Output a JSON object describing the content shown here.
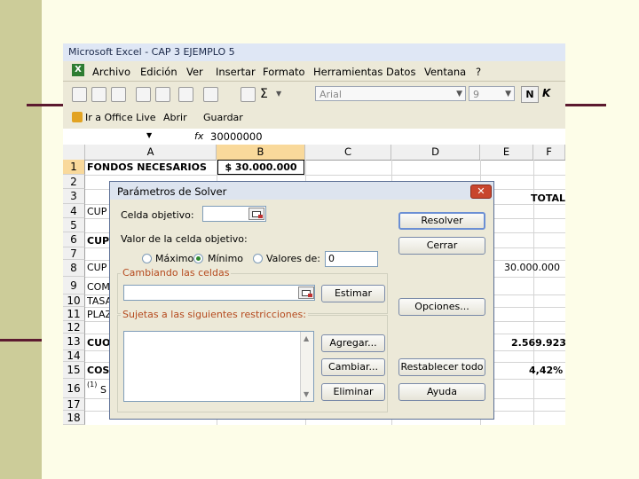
{
  "window": {
    "title": "Microsoft Excel - CAP 3 EJEMPLO 5"
  },
  "menu": [
    "Archivo",
    "Edición",
    "Ver",
    "Insertar",
    "Formato",
    "Herramientas",
    "Datos",
    "Ventana",
    "?"
  ],
  "toolbar": {
    "sigma": "Σ",
    "font_name": "Arial",
    "font_size": "9",
    "bold": "N",
    "italic": "K",
    "office_live": "Ir a Office Live",
    "open": "Abrir",
    "save": "Guardar"
  },
  "formula_bar": {
    "fx": "fx",
    "value": "30000000"
  },
  "columns": [
    "A",
    "B",
    "C",
    "D",
    "E",
    "F"
  ],
  "rows": [
    "1",
    "2",
    "3",
    "4",
    "5",
    "6",
    "7",
    "8",
    "9",
    "10",
    "11",
    "12",
    "13",
    "14",
    "15",
    "16",
    "17",
    "18"
  ],
  "cells": {
    "a1": "FONDOS NECESARIOS",
    "b1": "$ 30.000.000",
    "f3": "TOTAL",
    "a4": "CUP",
    "a6": "CUPO",
    "a8": "CUP",
    "f8": "30.000.000",
    "a9": "COM",
    "a10": "TASA",
    "a11": "PLAZ",
    "a13": "CUO",
    "f13": "2.569.923",
    "a15": "COS",
    "f15": "4,42%",
    "a16_sup": "(1)",
    "a16": "S"
  },
  "solver": {
    "title": "Parámetros de Solver",
    "target_label": "Celda objetivo:",
    "value_label": "Valor de la celda objetivo:",
    "opt_max": "Máximo",
    "opt_min": "Mínimo",
    "opt_value": "Valores de:",
    "value_input": "0",
    "changing_label": "Cambiando las celdas",
    "constraints_label": "Sujetas a las siguientes restricciones:",
    "buttons": {
      "solve": "Resolver",
      "close": "Cerrar",
      "guess": "Estimar",
      "options": "Opciones...",
      "add": "Agregar...",
      "change": "Cambiar...",
      "reset": "Restablecer todo",
      "delete": "Eliminar",
      "help": "Ayuda"
    }
  }
}
